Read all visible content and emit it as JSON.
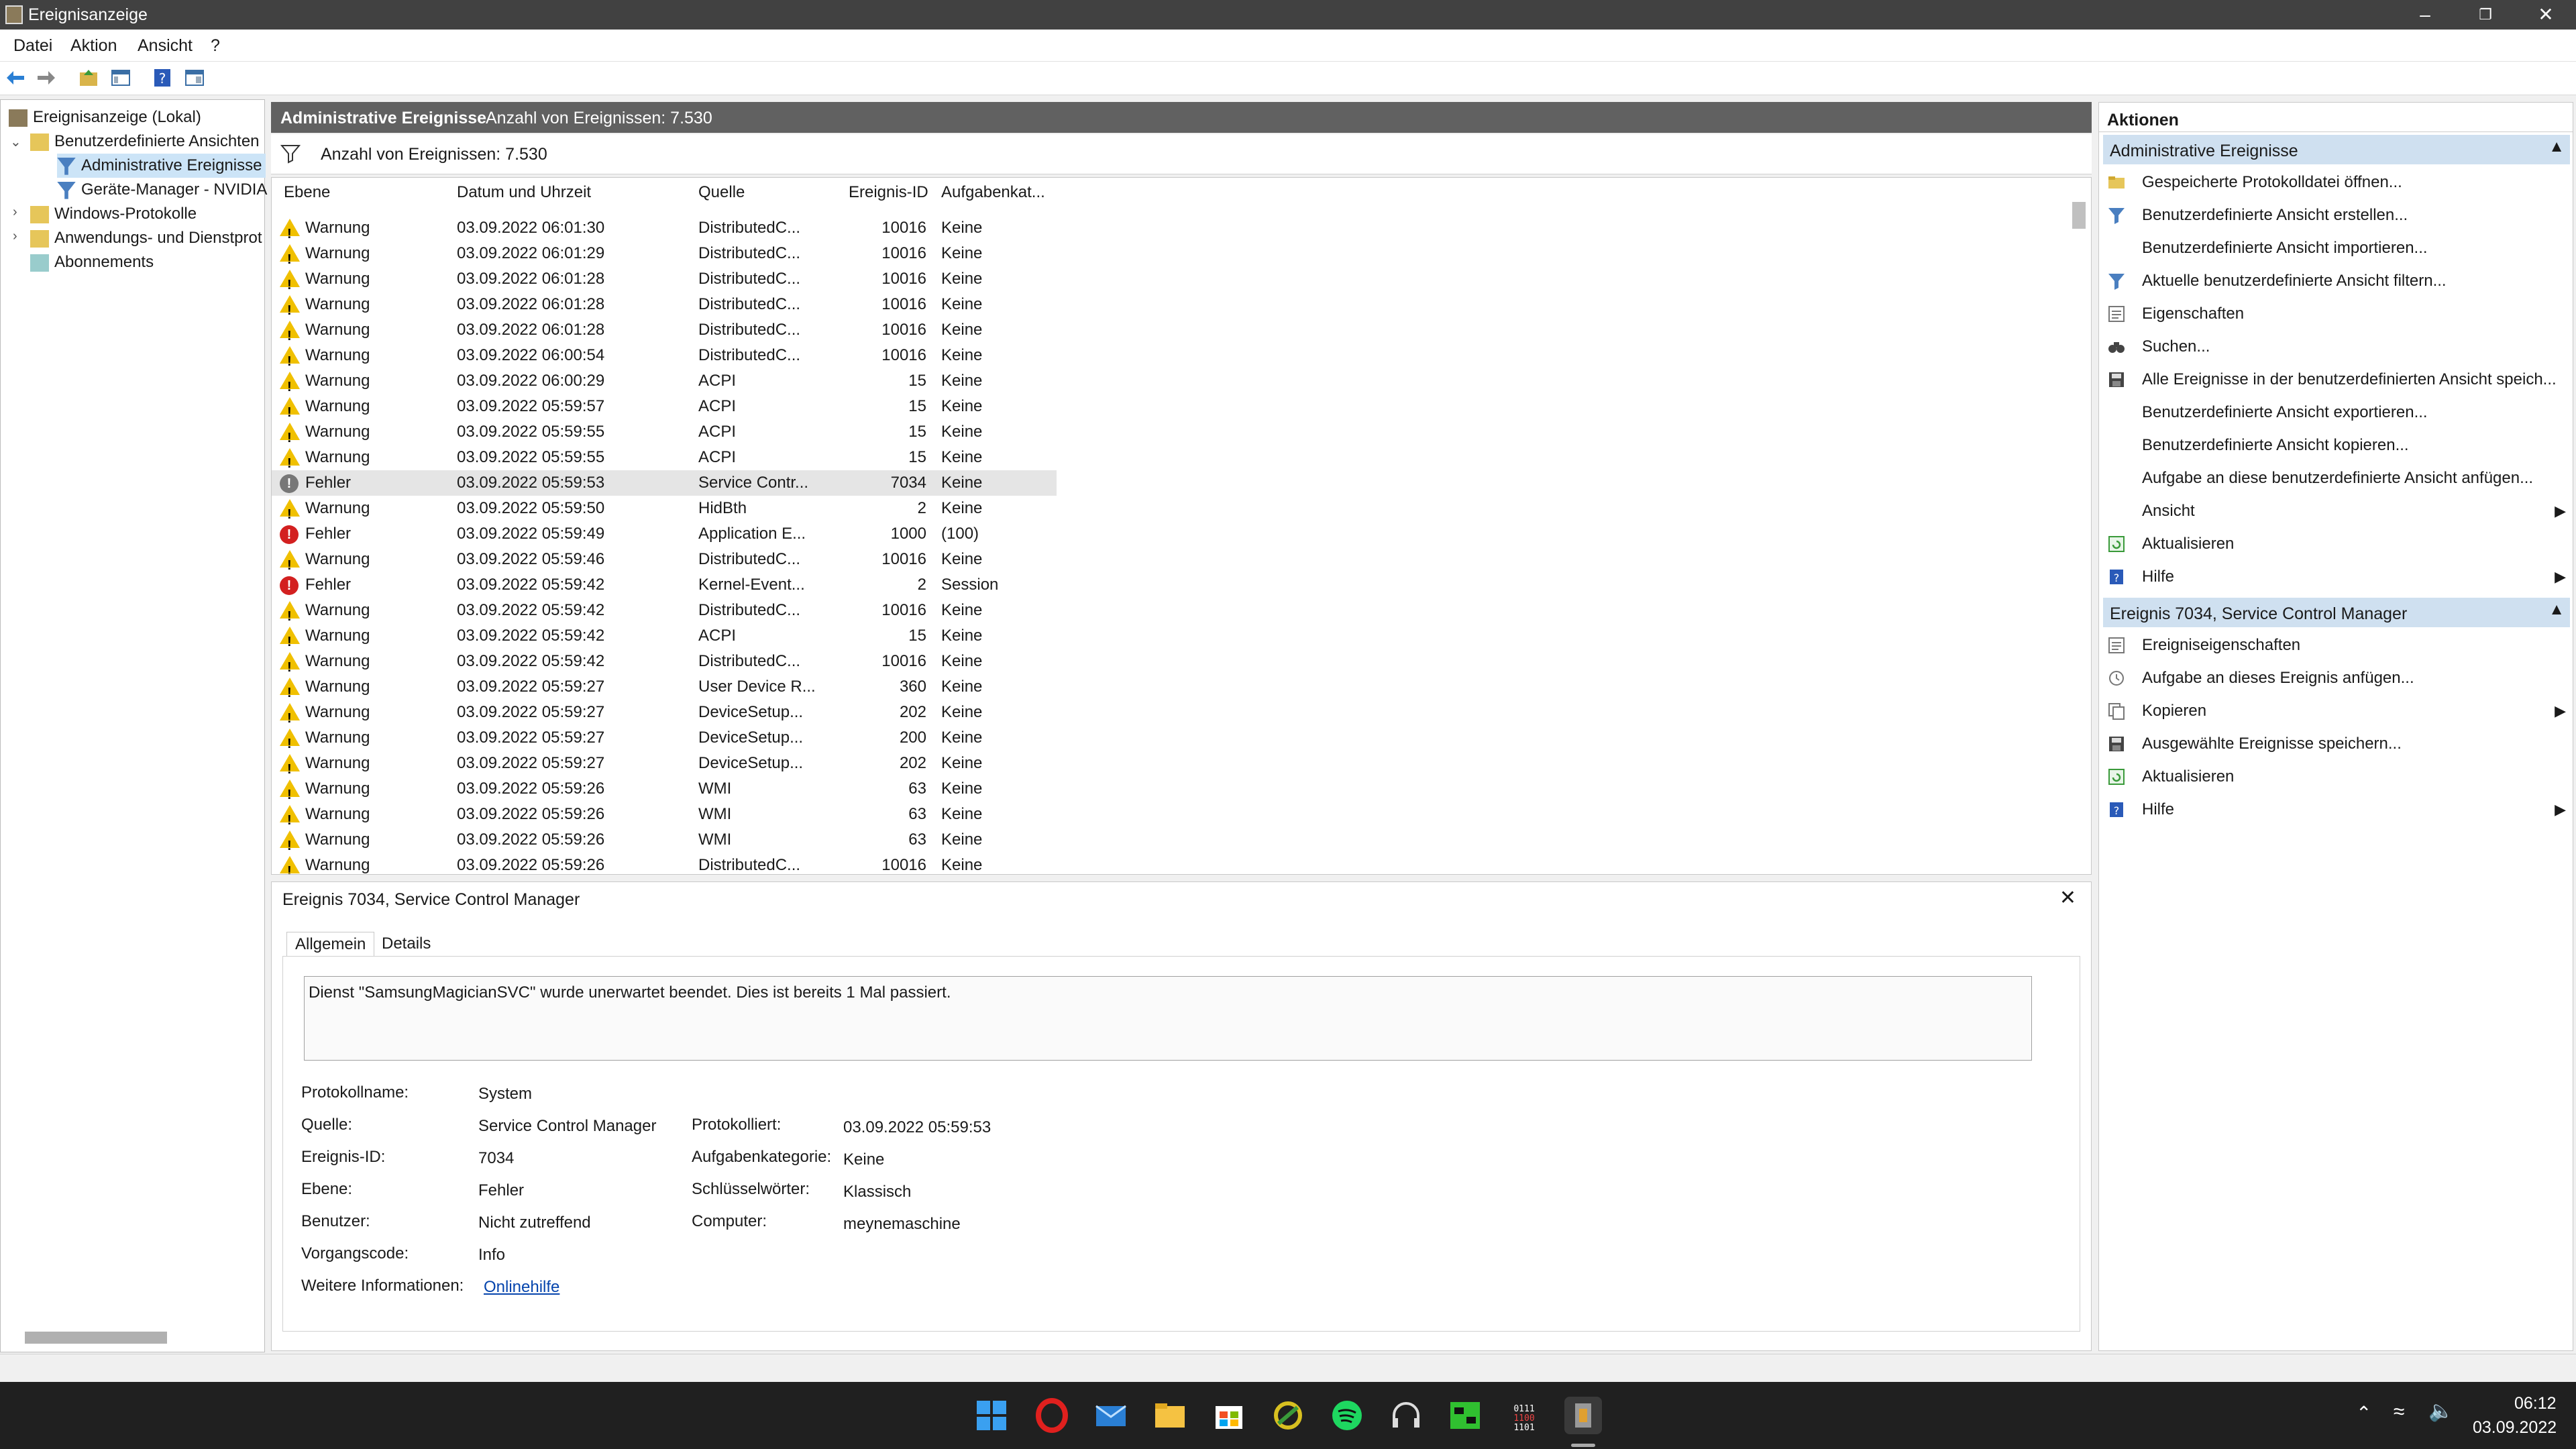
{
  "window": {
    "title": "Ereignisanzeige"
  },
  "menu": [
    "Datei",
    "Aktion",
    "Ansicht",
    "?"
  ],
  "tree": {
    "root": "Ereignisanzeige (Lokal)",
    "items": [
      "Benutzerdefinierte Ansichten",
      "Administrative Ereignisse",
      "Geräte-Manager - NVIDIA",
      "Windows-Protokolle",
      "Anwendungs- und Dienstprotokolle",
      "Abonnements"
    ]
  },
  "center": {
    "header_title": "Administrative Ereignisse",
    "header_count": "Anzahl von Ereignissen: 7.530",
    "filter_count": "Anzahl von Ereignissen: 7.530",
    "columns": [
      "Ebene",
      "Datum und Uhrzeit",
      "Quelle",
      "Ereignis-ID",
      "Aufgabenkat..."
    ],
    "rows": [
      {
        "level": "Warnung",
        "date": "03.09.2022 06:01:30",
        "source": "DistributedC...",
        "id": "10016",
        "task": "Keine"
      },
      {
        "level": "Warnung",
        "date": "03.09.2022 06:01:29",
        "source": "DistributedC...",
        "id": "10016",
        "task": "Keine"
      },
      {
        "level": "Warnung",
        "date": "03.09.2022 06:01:28",
        "source": "DistributedC...",
        "id": "10016",
        "task": "Keine"
      },
      {
        "level": "Warnung",
        "date": "03.09.2022 06:01:28",
        "source": "DistributedC...",
        "id": "10016",
        "task": "Keine"
      },
      {
        "level": "Warnung",
        "date": "03.09.2022 06:01:28",
        "source": "DistributedC...",
        "id": "10016",
        "task": "Keine"
      },
      {
        "level": "Warnung",
        "date": "03.09.2022 06:00:54",
        "source": "DistributedC...",
        "id": "10016",
        "task": "Keine"
      },
      {
        "level": "Warnung",
        "date": "03.09.2022 06:00:29",
        "source": "ACPI",
        "id": "15",
        "task": "Keine"
      },
      {
        "level": "Warnung",
        "date": "03.09.2022 05:59:57",
        "source": "ACPI",
        "id": "15",
        "task": "Keine"
      },
      {
        "level": "Warnung",
        "date": "03.09.2022 05:59:55",
        "source": "ACPI",
        "id": "15",
        "task": "Keine"
      },
      {
        "level": "Warnung",
        "date": "03.09.2022 05:59:55",
        "source": "ACPI",
        "id": "15",
        "task": "Keine"
      },
      {
        "level": "Fehler",
        "date": "03.09.2022 05:59:53",
        "source": "Service Contr...",
        "id": "7034",
        "task": "Keine",
        "selected": true
      },
      {
        "level": "Warnung",
        "date": "03.09.2022 05:59:50",
        "source": "HidBth",
        "id": "2",
        "task": "Keine"
      },
      {
        "level": "Fehler",
        "date": "03.09.2022 05:59:49",
        "source": "Application E...",
        "id": "1000",
        "task": "(100)"
      },
      {
        "level": "Warnung",
        "date": "03.09.2022 05:59:46",
        "source": "DistributedC...",
        "id": "10016",
        "task": "Keine"
      },
      {
        "level": "Fehler",
        "date": "03.09.2022 05:59:42",
        "source": "Kernel-Event...",
        "id": "2",
        "task": "Session"
      },
      {
        "level": "Warnung",
        "date": "03.09.2022 05:59:42",
        "source": "DistributedC...",
        "id": "10016",
        "task": "Keine"
      },
      {
        "level": "Warnung",
        "date": "03.09.2022 05:59:42",
        "source": "ACPI",
        "id": "15",
        "task": "Keine"
      },
      {
        "level": "Warnung",
        "date": "03.09.2022 05:59:42",
        "source": "DistributedC...",
        "id": "10016",
        "task": "Keine"
      },
      {
        "level": "Warnung",
        "date": "03.09.2022 05:59:27",
        "source": "User Device R...",
        "id": "360",
        "task": "Keine"
      },
      {
        "level": "Warnung",
        "date": "03.09.2022 05:59:27",
        "source": "DeviceSetup...",
        "id": "202",
        "task": "Keine"
      },
      {
        "level": "Warnung",
        "date": "03.09.2022 05:59:27",
        "source": "DeviceSetup...",
        "id": "200",
        "task": "Keine"
      },
      {
        "level": "Warnung",
        "date": "03.09.2022 05:59:27",
        "source": "DeviceSetup...",
        "id": "202",
        "task": "Keine"
      },
      {
        "level": "Warnung",
        "date": "03.09.2022 05:59:26",
        "source": "WMI",
        "id": "63",
        "task": "Keine"
      },
      {
        "level": "Warnung",
        "date": "03.09.2022 05:59:26",
        "source": "WMI",
        "id": "63",
        "task": "Keine"
      },
      {
        "level": "Warnung",
        "date": "03.09.2022 05:59:26",
        "source": "WMI",
        "id": "63",
        "task": "Keine"
      },
      {
        "level": "Warnung",
        "date": "03.09.2022 05:59:26",
        "source": "DistributedC...",
        "id": "10016",
        "task": "Keine"
      }
    ]
  },
  "detail": {
    "title": "Ereignis 7034, Service Control Manager",
    "tabs": [
      "Allgemein",
      "Details"
    ],
    "description": "Dienst \"SamsungMagicianSVC\" wurde unerwartet beendet. Dies ist bereits 1 Mal passiert.",
    "left_props": [
      {
        "label": "Protokollname:",
        "value": "System"
      },
      {
        "label": "Quelle:",
        "value": "Service Control Manager"
      },
      {
        "label": "Ereignis-ID:",
        "value": "7034"
      },
      {
        "label": "Ebene:",
        "value": "Fehler"
      },
      {
        "label": "Benutzer:",
        "value": "Nicht zutreffend"
      },
      {
        "label": "Vorgangscode:",
        "value": "Info"
      },
      {
        "label": "Weitere Informationen:",
        "value": "Onlinehilfe"
      }
    ],
    "right_props": [
      {
        "label": "Protokolliert:",
        "value": "03.09.2022 05:59:53"
      },
      {
        "label": "Aufgabenkategorie:",
        "value": "Keine"
      },
      {
        "label": "Schlüsselwörter:",
        "value": "Klassisch"
      },
      {
        "label": "Computer:",
        "value": "meynemaschine"
      }
    ]
  },
  "actions": {
    "title": "Aktionen",
    "section1": "Administrative Ereignisse",
    "items1": [
      {
        "label": "Gespeicherte Protokolldatei öffnen...",
        "icon": "folder-open-icon"
      },
      {
        "label": "Benutzerdefinierte Ansicht erstellen...",
        "icon": "filter-icon"
      },
      {
        "label": "Benutzerdefinierte Ansicht importieren...",
        "icon": ""
      },
      {
        "label": "Aktuelle benutzerdefinierte Ansicht filtern...",
        "icon": "filter-icon"
      },
      {
        "label": "Eigenschaften",
        "icon": "properties-icon"
      },
      {
        "label": "Suchen...",
        "icon": "binoculars-icon"
      },
      {
        "label": "Alle Ereignisse in der benutzerdefinierten Ansicht speich...",
        "icon": "save-icon"
      },
      {
        "label": "Benutzerdefinierte Ansicht exportieren...",
        "icon": ""
      },
      {
        "label": "Benutzerdefinierte Ansicht kopieren...",
        "icon": ""
      },
      {
        "label": "Aufgabe an diese benutzerdefinierte Ansicht anfügen...",
        "icon": ""
      },
      {
        "label": "Ansicht",
        "icon": "",
        "submenu": true
      },
      {
        "label": "Aktualisieren",
        "icon": "refresh-icon"
      },
      {
        "label": "Hilfe",
        "icon": "help-icon",
        "submenu": true
      }
    ],
    "section2": "Ereignis 7034, Service Control Manager",
    "items2": [
      {
        "label": "Ereigniseigenschaften",
        "icon": "properties-icon"
      },
      {
        "label": "Aufgabe an dieses Ereignis anfügen...",
        "icon": "task-icon"
      },
      {
        "label": "Kopieren",
        "icon": "copy-icon",
        "submenu": true
      },
      {
        "label": "Ausgewählte Ereignisse speichern...",
        "icon": "save-icon"
      },
      {
        "label": "Aktualisieren",
        "icon": "refresh-icon"
      },
      {
        "label": "Hilfe",
        "icon": "help-icon",
        "submenu": true
      }
    ]
  },
  "taskbar": {
    "time": "06:12",
    "date": "03.09.2022"
  },
  "colors": {
    "header_bg": "#616161",
    "section_bg": "#cfe0f0",
    "taskbar_bg": "#202020",
    "warning": "#f0c000",
    "error": "#d32020"
  }
}
